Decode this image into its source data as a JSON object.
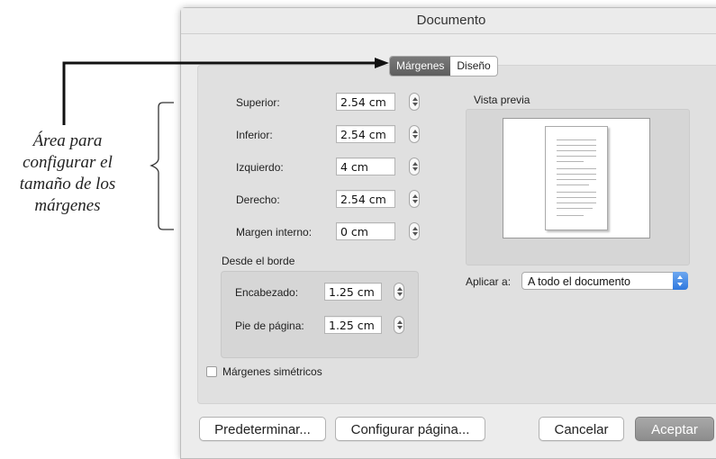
{
  "annotation": {
    "lines": [
      "Área para",
      "configurar el",
      "tamaño de los",
      "márgenes"
    ]
  },
  "dialog": {
    "title": "Documento",
    "tabs": [
      {
        "label": "Márgenes",
        "active": true
      },
      {
        "label": "Diseño",
        "active": false
      }
    ],
    "fields": {
      "superior": {
        "label": "Superior:",
        "value": "2.54 cm"
      },
      "inferior": {
        "label": "Inferior:",
        "value": "2.54 cm"
      },
      "izquierdo": {
        "label": "Izquierdo:",
        "value": "4 cm"
      },
      "derecho": {
        "label": "Derecho:",
        "value": "2.54 cm"
      },
      "margen_interno": {
        "label": "Margen interno:",
        "value": "0 cm"
      }
    },
    "desde_el_borde": {
      "title": "Desde el borde",
      "encabezado": {
        "label": "Encabezado:",
        "value": "1.25 cm"
      },
      "pie": {
        "label": "Pie de página:",
        "value": "1.25 cm"
      }
    },
    "preview": {
      "label": "Vista previa"
    },
    "apply_to": {
      "label": "Aplicar a:",
      "selected": "A todo el documento"
    },
    "mirror_margins": {
      "label": "Márgenes simétricos",
      "checked": false
    },
    "buttons": {
      "default": "Predeterminar...",
      "page_setup": "Configurar página...",
      "cancel": "Cancelar",
      "accept": "Aceptar"
    }
  }
}
